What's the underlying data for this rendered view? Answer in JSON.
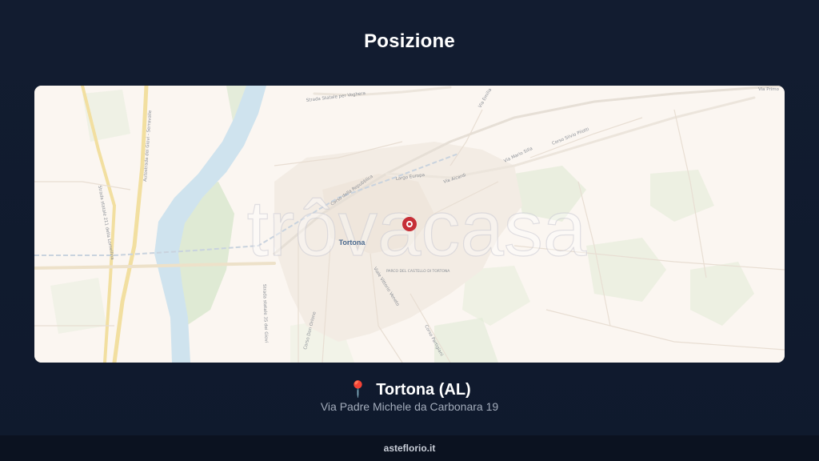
{
  "header": {
    "title": "Posizione"
  },
  "map": {
    "watermark": "trôvacasa",
    "city_label": "Tortona",
    "street_labels": [
      "Strada Statale per Voghera",
      "Via Emilia",
      "Corso Silvio Pilotti",
      "Via Primo",
      "Corso della Repubblica",
      "Largo Europa",
      "Via Aicardi",
      "Via Mario Silla",
      "Strada statale 211 della Lomellina",
      "Autostrada dei Giovi - Serravalle",
      "Strada statale 35 dei Giovi",
      "Viale Vittorio Veneto",
      "Corso Don Orione",
      "Corso Partigiani",
      "PARCO DEL CASTELLO DI TORTONA"
    ],
    "marker_icon": "map-pin-marker"
  },
  "location": {
    "pin_icon": "📍",
    "place": "Tortona (AL)",
    "address": "Via Padre Michele da Carbonara 19"
  },
  "footer": {
    "site": "asteflorio.it"
  }
}
